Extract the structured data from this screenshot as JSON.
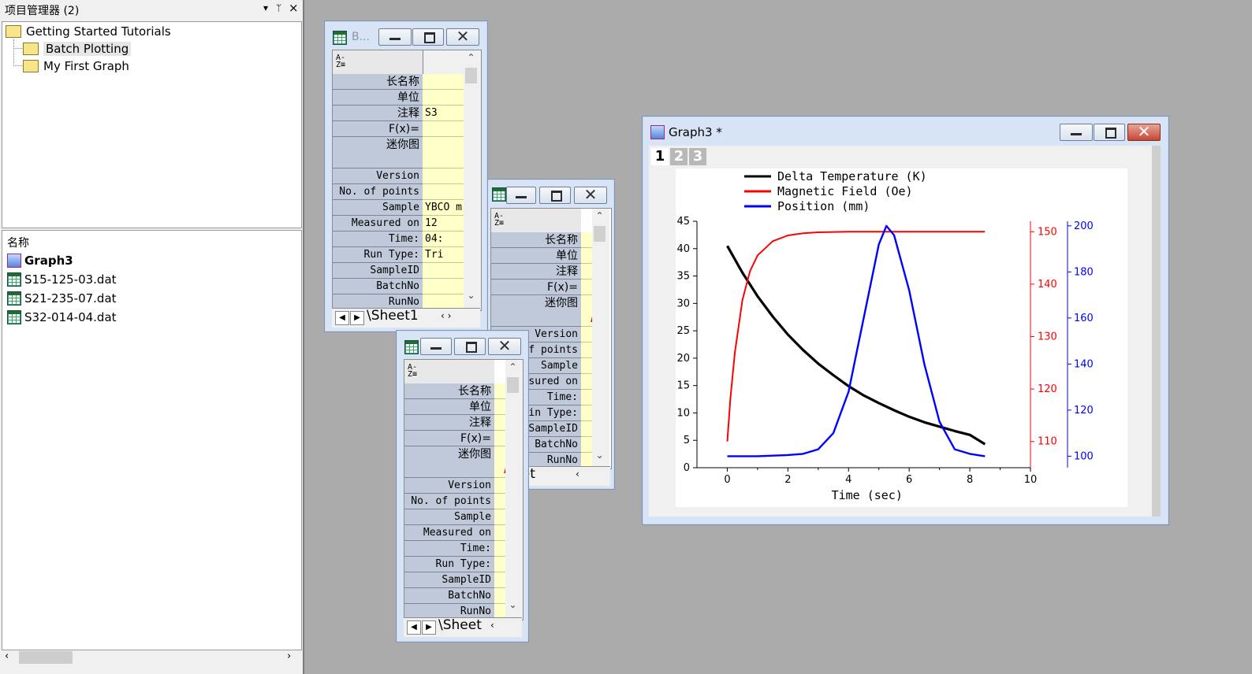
{
  "project_manager": {
    "title": "项目管理器 (2)",
    "controls": {
      "dropdown": "▾",
      "pin": "ᛘ",
      "close": "×"
    },
    "tree": {
      "root": "Getting Started Tutorials",
      "children": [
        "Batch Plotting",
        "My First Graph"
      ],
      "selected": "Batch Plotting"
    },
    "list": {
      "header": "名称",
      "items": [
        {
          "name": "Graph3",
          "type": "graph",
          "bold": true
        },
        {
          "name": "S15-125-03.dat",
          "type": "workbook"
        },
        {
          "name": "S21-235-07.dat",
          "type": "workbook"
        },
        {
          "name": "S32-014-04.dat",
          "type": "workbook"
        }
      ]
    }
  },
  "workbook_a": {
    "title": "B...",
    "rows": [
      {
        "label": "长名称",
        "value": ""
      },
      {
        "label": "单位",
        "value": ""
      },
      {
        "label": "注释",
        "value": "S3"
      },
      {
        "label": "F(x)=",
        "value": ""
      },
      {
        "label": "迷你图",
        "value": ""
      },
      {
        "label": "Version",
        "value": ""
      },
      {
        "label": "No. of points",
        "value": ""
      },
      {
        "label": "Sample",
        "value": "YBCO m"
      },
      {
        "label": "Measured on",
        "value": "12"
      },
      {
        "label": "Time:",
        "value": "04:"
      },
      {
        "label": "Run Type:",
        "value": "Tri"
      },
      {
        "label": "SampleID",
        "value": ""
      },
      {
        "label": "BatchNo",
        "value": ""
      },
      {
        "label": "RunNo",
        "value": ""
      }
    ],
    "sheet_tab": "Sheet1",
    "nav": {
      "prev": "◀",
      "next": "▶"
    }
  },
  "workbook_b": {
    "rows": [
      {
        "label": "长名称"
      },
      {
        "label": "单位"
      },
      {
        "label": "注释"
      },
      {
        "label": "F(x)="
      },
      {
        "label": "迷你图"
      },
      {
        "label": "Version"
      },
      {
        "label": "f points"
      },
      {
        "label": "Sample"
      },
      {
        "label": "sured on"
      },
      {
        "label": "Time:"
      },
      {
        "label": "in Type:"
      },
      {
        "label": "SampleID"
      },
      {
        "label": "BatchNo"
      },
      {
        "label": "RunNo"
      }
    ],
    "sheet_tab": "Sheet"
  },
  "workbook_c": {
    "rows": [
      {
        "label": "长名称"
      },
      {
        "label": "单位"
      },
      {
        "label": "注释"
      },
      {
        "label": "F(x)="
      },
      {
        "label": "迷你图"
      },
      {
        "label": "Version"
      },
      {
        "label": "No. of points"
      },
      {
        "label": "Sample"
      },
      {
        "label": "Measured on"
      },
      {
        "label": "Time:"
      },
      {
        "label": "Run Type:"
      },
      {
        "label": "SampleID"
      },
      {
        "label": "BatchNo"
      },
      {
        "label": "RunNo"
      }
    ],
    "sheet_tab": "Sheet",
    "nav": {
      "prev": "◀",
      "next": "▶"
    }
  },
  "graph_window": {
    "title": "Graph3 *",
    "layer_tabs": [
      "1",
      "2",
      "3"
    ],
    "active_layer": "1"
  },
  "chart_data": {
    "type": "line",
    "title": "",
    "xlabel": "Time (sec)",
    "xlim": [
      -1,
      10
    ],
    "x_ticks": [
      "0",
      "2",
      "4",
      "6",
      "8",
      "10"
    ],
    "ylim_left": [
      0,
      45
    ],
    "y_ticks_left": [
      "0",
      "5",
      "10",
      "15",
      "20",
      "25",
      "30",
      "35",
      "40",
      "45"
    ],
    "ylim_right_red": [
      105,
      152
    ],
    "y_ticks_right_red": [
      "110",
      "120",
      "130",
      "140",
      "150"
    ],
    "ylim_right_blue": [
      95,
      202
    ],
    "y_ticks_right_blue": [
      "100",
      "120",
      "140",
      "160",
      "180",
      "200"
    ],
    "legend_position": "top-left",
    "grid": false,
    "colors": {
      "temperature": "#000000",
      "field": "#ff0000",
      "position": "#0000ff"
    },
    "series": [
      {
        "name": "Delta Temperature (K)",
        "axis": "left",
        "x": [
          0,
          0.5,
          1,
          1.5,
          2,
          2.5,
          3,
          3.5,
          4,
          4.5,
          5,
          5.5,
          6,
          6.5,
          7,
          7.5,
          8,
          8.5
        ],
        "values": [
          40.5,
          35.6,
          31.3,
          27.6,
          24.3,
          21.5,
          19.0,
          16.9,
          14.9,
          13.2,
          11.8,
          10.5,
          9.3,
          8.3,
          7.5,
          6.7,
          6.0,
          4.3
        ]
      },
      {
        "name": "Magnetic Field (Oe)",
        "axis": "right_red",
        "x": [
          0,
          0.1,
          0.25,
          0.5,
          0.75,
          1,
          1.5,
          2,
          2.5,
          3,
          4,
          5,
          6,
          7,
          8,
          8.5
        ],
        "values": [
          110,
          118,
          127,
          137,
          142.5,
          145.5,
          148.2,
          149.3,
          149.7,
          149.9,
          150,
          150,
          150,
          150,
          150,
          150
        ]
      },
      {
        "name": "Position (mm)",
        "axis": "right_blue",
        "x": [
          0,
          1,
          2,
          2.5,
          3,
          3.5,
          4,
          4.5,
          5,
          5.25,
          5.5,
          6,
          6.5,
          7,
          7.5,
          8,
          8.5
        ],
        "values": [
          100,
          100,
          100.5,
          101,
          103,
          110,
          128,
          160,
          192,
          200,
          196,
          172,
          140,
          115,
          103,
          101,
          100
        ]
      }
    ]
  }
}
